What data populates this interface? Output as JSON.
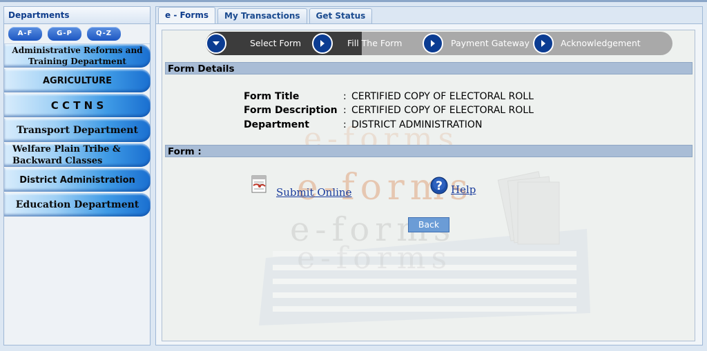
{
  "sidebar": {
    "title": "Departments",
    "alpha_buttons": [
      "A-F",
      "G-P",
      "Q-Z"
    ],
    "items": [
      {
        "line1": "Administrative Reforms and",
        "line2": "Training Department"
      },
      {
        "line1": "AGRICULTURE",
        "line2": ""
      },
      {
        "line1": "C C T N S",
        "line2": ""
      },
      {
        "line1": "Transport Department",
        "line2": ""
      },
      {
        "line1": "Welfare Plain Tribe &",
        "line2": "Backward Classes"
      },
      {
        "line1": "District Administration",
        "line2": ""
      },
      {
        "line1": "Education Department",
        "line2": ""
      }
    ]
  },
  "tabs": [
    {
      "label": "e - Forms",
      "active": true
    },
    {
      "label": "My Transactions",
      "active": false
    },
    {
      "label": "Get Status",
      "active": false
    }
  ],
  "steps": [
    {
      "label": "Select Form",
      "active": true
    },
    {
      "label": "Fill The Form",
      "active": false
    },
    {
      "label": "Payment Gateway",
      "active": false
    },
    {
      "label": "Acknowledgement",
      "active": false
    }
  ],
  "form_details": {
    "heading": "Form Details",
    "rows": [
      {
        "label": "Form Title",
        "value": "CERTIFIED COPY OF ELECTORAL ROLL"
      },
      {
        "label": "Form Description",
        "value": "CERTIFIED COPY OF ELECTORAL ROLL"
      },
      {
        "label": "Department",
        "value": "DISTRICT ADMINISTRATION"
      }
    ],
    "separator": ":"
  },
  "form_section": {
    "heading": "Form :",
    "submit_label": "Submit Online",
    "help_label": "Help",
    "back_label": "Back"
  },
  "watermark_text": "e-forms",
  "colors": {
    "accent": "#0f3d8c",
    "step_active_bg": "#3c3c3c",
    "step_inactive_bg": "#a9a9a9",
    "section_bar": "#a9bdd6",
    "back_button": "#6b9cd6",
    "link": "#1a3c9c"
  }
}
